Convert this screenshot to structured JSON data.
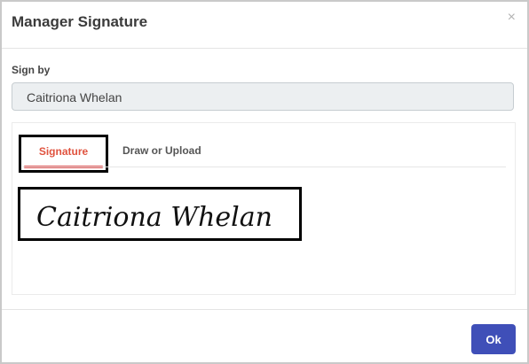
{
  "dialog": {
    "title": "Manager Signature",
    "close_glyph": "×"
  },
  "sign_by": {
    "label": "Sign by",
    "value": "Caitriona Whelan"
  },
  "tabs": [
    {
      "label": "Signature",
      "active": true
    },
    {
      "label": "Draw or Upload",
      "active": false
    }
  ],
  "signature": {
    "text": "Caitriona Whelan"
  },
  "footer": {
    "ok_label": "Ok"
  },
  "colors": {
    "accent": "#3f4fb8",
    "active_tab": "#e05353",
    "field_bg": "#eceff1"
  }
}
